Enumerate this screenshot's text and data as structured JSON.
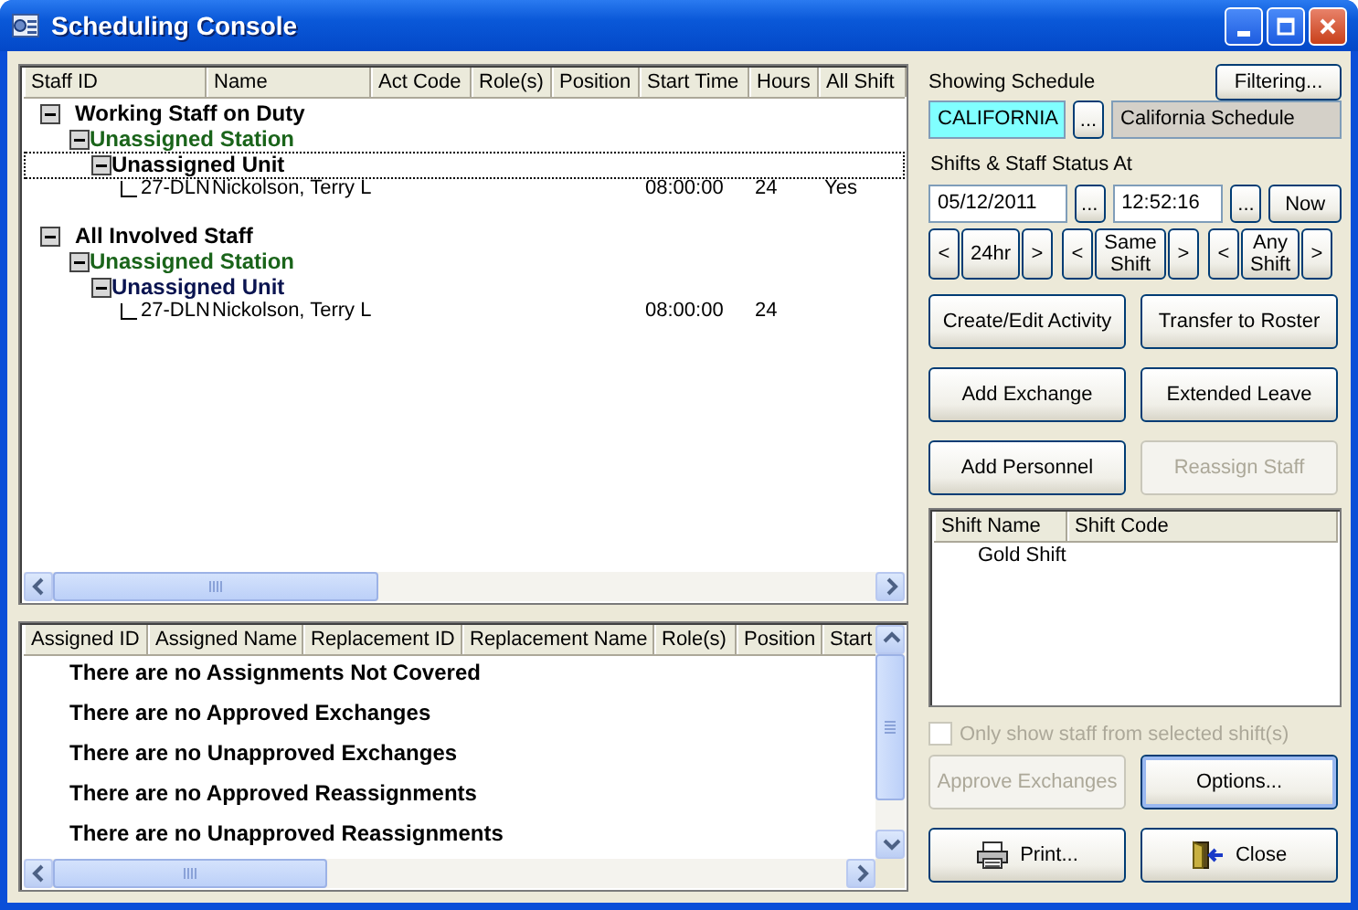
{
  "window": {
    "title": "Scheduling Console"
  },
  "staff_table": {
    "columns": [
      "Staff ID",
      "Name",
      "Act Code",
      "Role(s)",
      "Position",
      "Start Time",
      "Hours",
      "All Shift"
    ],
    "groups": [
      {
        "kind": "group",
        "label": "Working Staff on Duty",
        "color": "#000000",
        "expanded": true,
        "focused": false,
        "children": [
          {
            "kind": "group",
            "label": "Unassigned Station",
            "color": "#1a641a",
            "expanded": true,
            "focused": false,
            "children": [
              {
                "kind": "group",
                "label": "Unassigned Unit",
                "color": "#000000",
                "expanded": true,
                "focused": true,
                "children": [
                  {
                    "kind": "staff",
                    "staff_id": "27-DLN",
                    "name": "Nickolson, Terry L",
                    "start_time": "08:00:00",
                    "hours": "24",
                    "all_shift": "Yes"
                  }
                ]
              }
            ]
          }
        ]
      },
      {
        "kind": "group",
        "label": "All Involved Staff",
        "color": "#000000",
        "expanded": true,
        "focused": false,
        "children": [
          {
            "kind": "group",
            "label": "Unassigned Station",
            "color": "#1a641a",
            "expanded": true,
            "focused": false,
            "children": [
              {
                "kind": "group",
                "label": "Unassigned Unit",
                "color": "#0a1450",
                "expanded": true,
                "focused": false,
                "children": [
                  {
                    "kind": "staff",
                    "staff_id": "27-DLN",
                    "name": "Nickolson, Terry L",
                    "start_time": "08:00:00",
                    "hours": "24"
                  }
                ]
              }
            ]
          }
        ]
      }
    ]
  },
  "exchange_table": {
    "columns": [
      "Assigned ID",
      "Assigned Name",
      "Replacement ID",
      "Replacement Name",
      "Role(s)",
      "Position",
      "Start"
    ],
    "messages": [
      "There are no Assignments Not Covered",
      "There are no Approved Exchanges",
      "There are no Unapproved Exchanges",
      "There are no Approved Reassignments",
      "There are no Unapproved Reassignments"
    ]
  },
  "schedule": {
    "label": "Showing Schedule",
    "filter_button": "Filtering...",
    "code": "CALIFORNIA",
    "browse_button": "...",
    "name": "California Schedule"
  },
  "status_at": {
    "label": "Shifts & Staff Status At",
    "date": "05/12/2011",
    "date_button": "...",
    "time": "12:52:16",
    "time_button": "...",
    "now_button": "Now",
    "steppers": [
      {
        "prev": "<",
        "label": "24hr",
        "next": ">"
      },
      {
        "prev": "<",
        "label": "Same Shift",
        "next": ">"
      },
      {
        "prev": "<",
        "label": "Any Shift",
        "next": ">"
      }
    ]
  },
  "actions": [
    {
      "label": "Create/Edit Activity",
      "disabled": false
    },
    {
      "label": "Transfer to Roster",
      "disabled": false
    },
    {
      "label": "Add Exchange",
      "disabled": false
    },
    {
      "label": "Extended Leave",
      "disabled": false
    },
    {
      "label": "Add Personnel",
      "disabled": false
    },
    {
      "label": "Reassign Staff",
      "disabled": true
    }
  ],
  "shift_list": {
    "columns": [
      "Shift Name",
      "Shift Code"
    ],
    "rows": [
      {
        "shift_name": "Gold Shift"
      }
    ]
  },
  "only_selected_shifts": {
    "label": "Only show staff from selected shift(s)",
    "checked": false,
    "disabled": true
  },
  "bottom_buttons": [
    {
      "kind": "plain",
      "label": "Approve Exchanges",
      "disabled": true,
      "default": false
    },
    {
      "kind": "plain",
      "label": "Options...",
      "disabled": false,
      "default": true
    },
    {
      "kind": "print",
      "label": "Print...",
      "disabled": false,
      "default": false
    },
    {
      "kind": "close",
      "label": "Close",
      "disabled": false,
      "default": false
    }
  ]
}
